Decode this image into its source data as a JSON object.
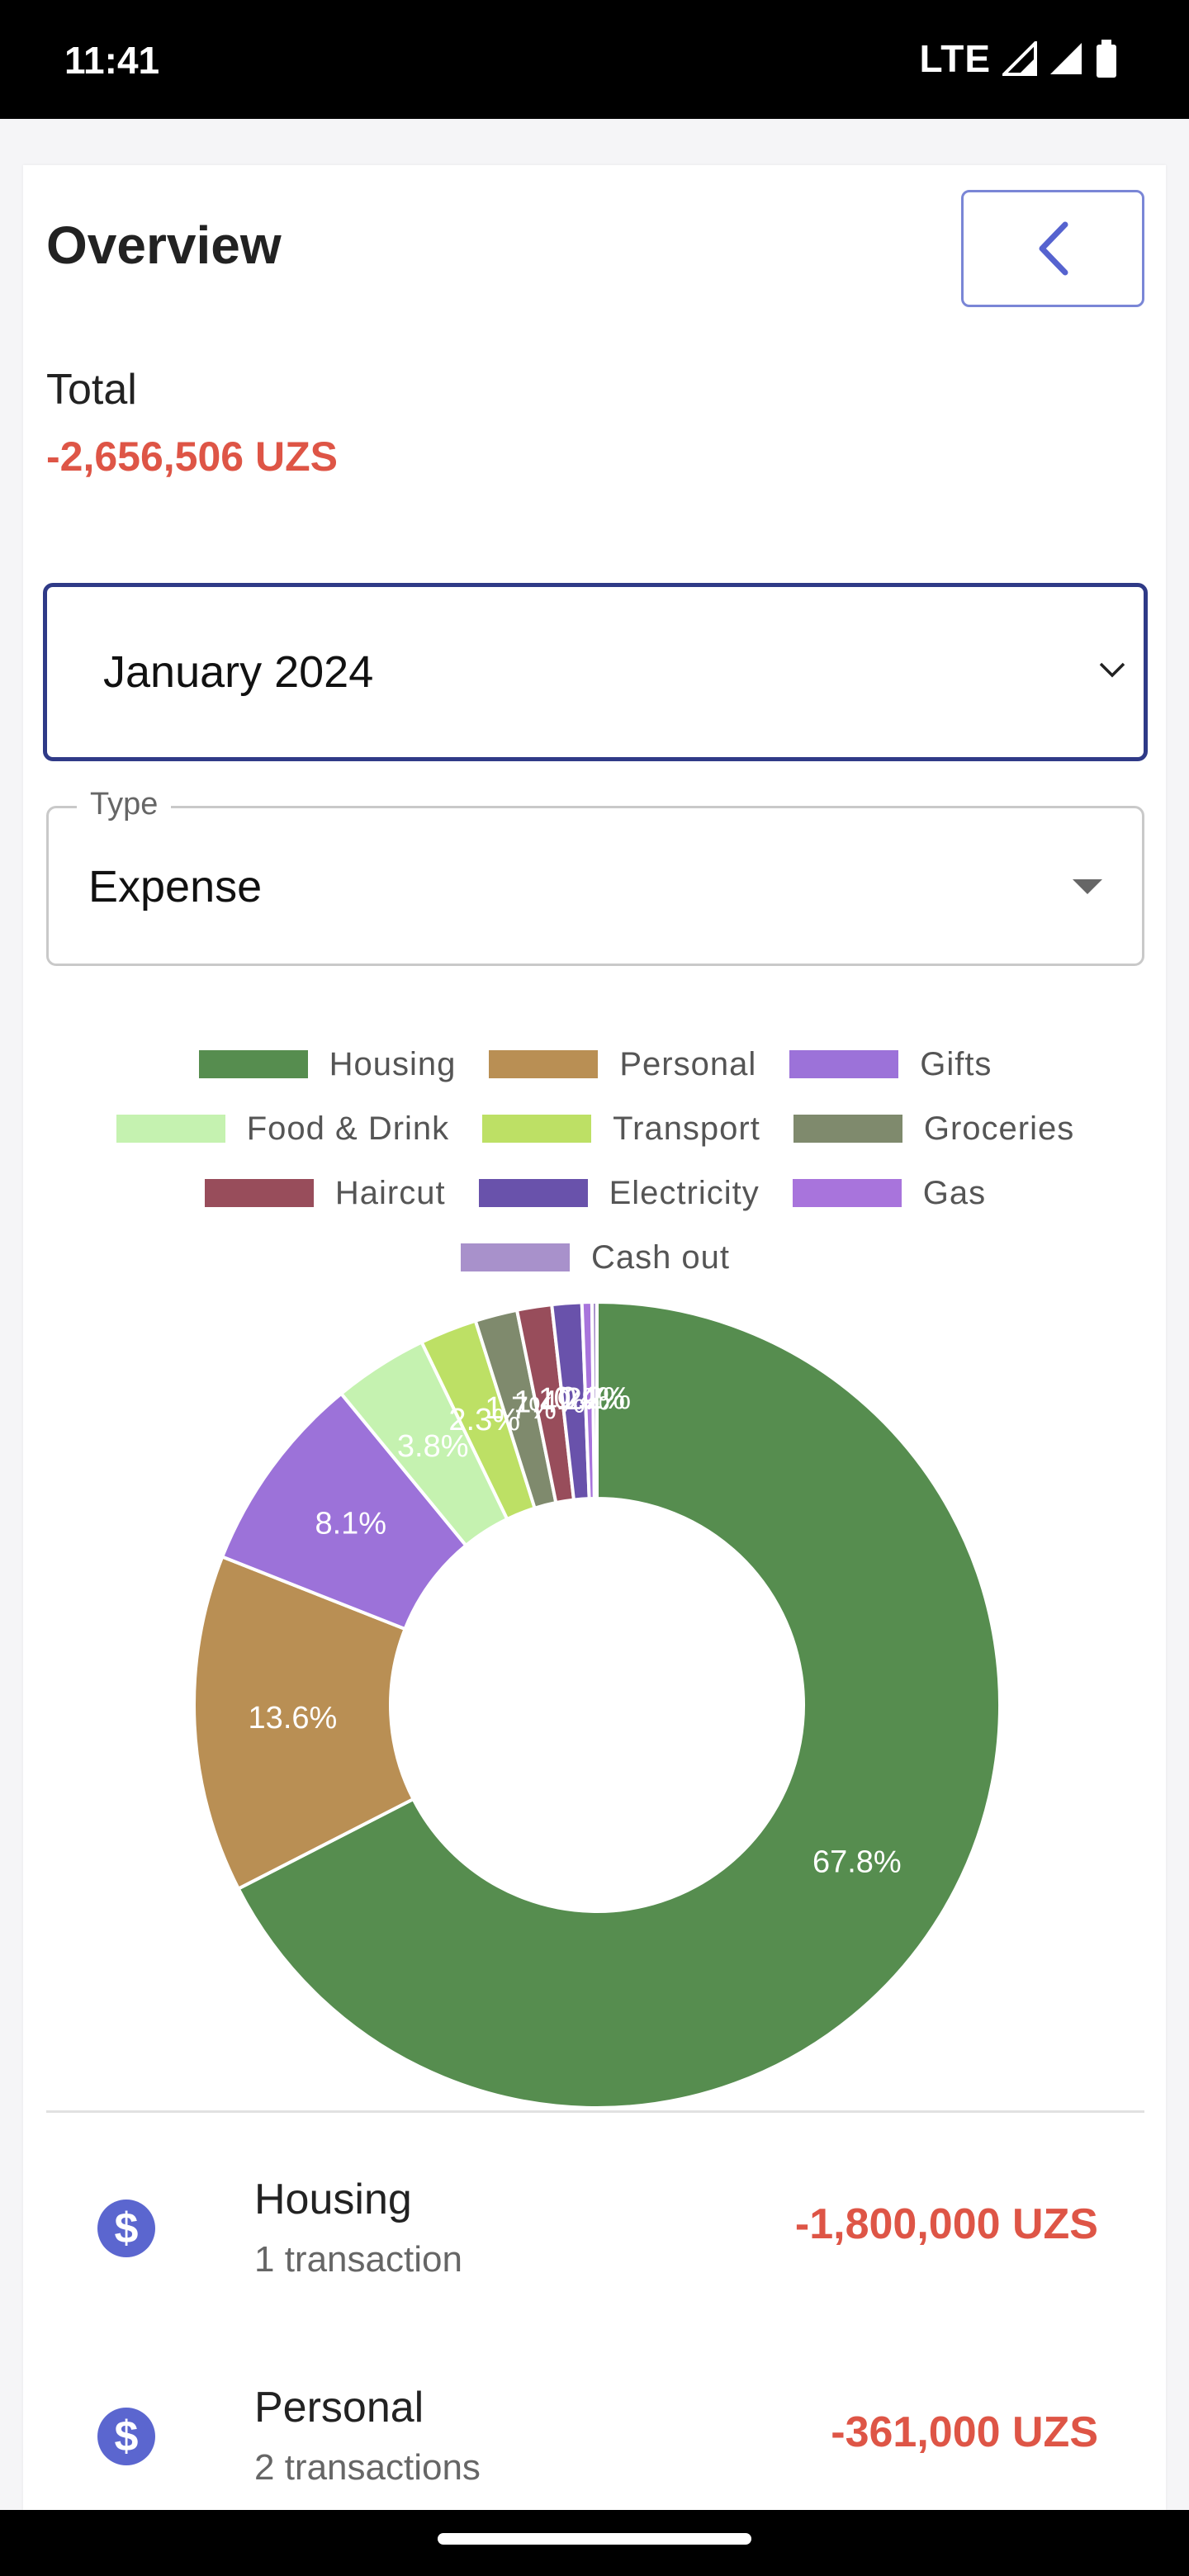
{
  "status_bar": {
    "time": "11:41",
    "network": "LTE"
  },
  "header": {
    "title": "Overview"
  },
  "total": {
    "label": "Total",
    "value": "-2,656,506 UZS"
  },
  "month_select": {
    "value": "January 2024"
  },
  "type_field": {
    "label": "Type",
    "value": "Expense"
  },
  "legend": [
    {
      "label": "Housing",
      "color": "#568d4f"
    },
    {
      "label": "Personal",
      "color": "#b98f54"
    },
    {
      "label": "Gifts",
      "color": "#9c72d9"
    },
    {
      "label": "Food & Drink",
      "color": "#c5f2b0"
    },
    {
      "label": "Transport",
      "color": "#bde065"
    },
    {
      "label": "Groceries",
      "color": "#7f8a6d"
    },
    {
      "label": "Haircut",
      "color": "#984d5b"
    },
    {
      "label": "Electricity",
      "color": "#6952ab"
    },
    {
      "label": "Gas",
      "color": "#a874dc"
    },
    {
      "label": "Cash out",
      "color": "#a891cb"
    }
  ],
  "chart_data": {
    "type": "pie",
    "categories": [
      "Housing",
      "Personal",
      "Gifts",
      "Food & Drink",
      "Transport",
      "Groceries",
      "Haircut",
      "Electricity",
      "Gas",
      "Cash out"
    ],
    "values": [
      67.8,
      13.6,
      8.1,
      3.8,
      2.3,
      1.7,
      1.4,
      1.2,
      0.4,
      0.2
    ],
    "labels": [
      "67.8%",
      "13.6%",
      "8.1%",
      "3.8%",
      "2.3%",
      "1.7%",
      "1.4%",
      "1.2%",
      "0.4%",
      "0.2%"
    ],
    "colors": [
      "#568d4f",
      "#b98f54",
      "#9c72d9",
      "#c5f2b0",
      "#bde065",
      "#7f8a6d",
      "#984d5b",
      "#6952ab",
      "#a874dc",
      "#a891cb"
    ]
  },
  "transactions": [
    {
      "category": "Housing",
      "count": "1 transaction",
      "amount": "-1,800,000 UZS",
      "icon": "dollar-icon"
    },
    {
      "category": "Personal",
      "count": "2 transactions",
      "amount": "-361,000 UZS",
      "icon": "dollar-icon"
    }
  ]
}
